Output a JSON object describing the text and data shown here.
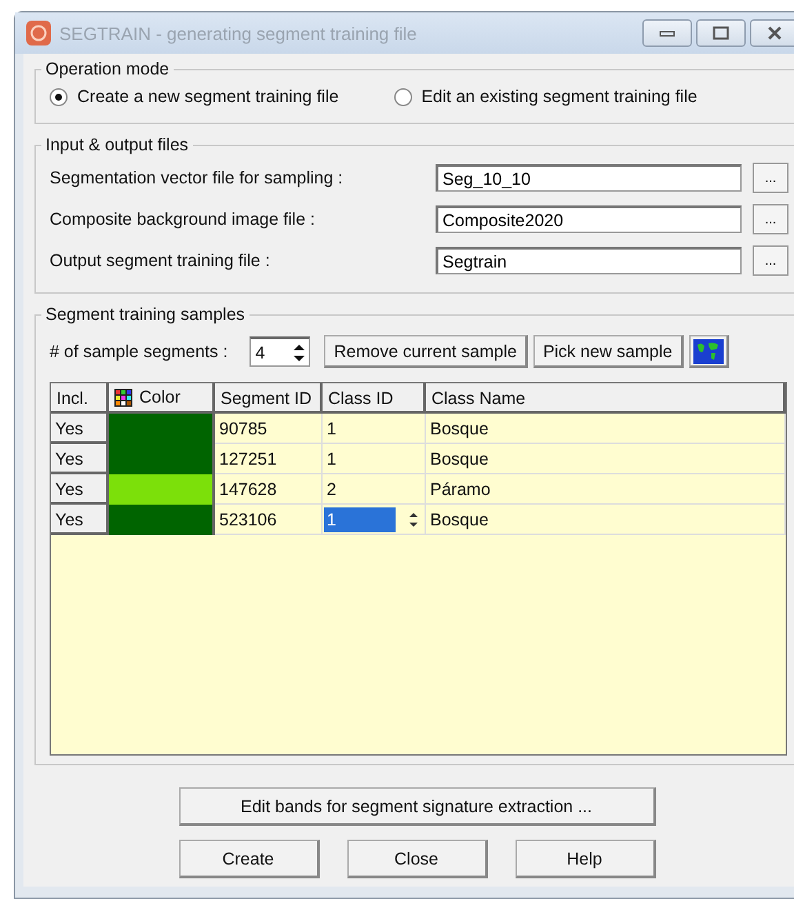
{
  "window": {
    "title": "SEGTRAIN - generating segment training file"
  },
  "operation_mode": {
    "title": "Operation mode",
    "options": [
      {
        "label": "Create a new segment training file",
        "selected": true
      },
      {
        "label": "Edit an existing segment training file",
        "selected": false
      }
    ]
  },
  "files": {
    "title": "Input & output files",
    "rows": [
      {
        "label": "Segmentation vector file for sampling :",
        "value": "Seg_10_10",
        "button": "..."
      },
      {
        "label": "Composite background image file :",
        "value": "Composite2020",
        "button": "..."
      },
      {
        "label": "Output segment training file :",
        "value": "Segtrain",
        "button": "..."
      }
    ]
  },
  "samples": {
    "title": "Segment training samples",
    "count_label": "# of sample segments :",
    "count": "4",
    "buttons": [
      "Remove current sample",
      "Pick new sample"
    ],
    "table": {
      "columns": [
        "Incl.",
        "Color",
        "Segment ID",
        "Class ID",
        "Class Name"
      ],
      "rows": [
        {
          "incl": "Yes",
          "color": "#006400",
          "segment_id": "90785",
          "class_id": "1",
          "class_name": "Bosque",
          "selected": false
        },
        {
          "incl": "Yes",
          "color": "#006400",
          "segment_id": "127251",
          "class_id": "1",
          "class_name": "Bosque",
          "selected": false
        },
        {
          "incl": "Yes",
          "color": "#7ce00a",
          "segment_id": "147628",
          "class_id": "2",
          "class_name": "Páramo",
          "selected": false
        },
        {
          "incl": "Yes",
          "color": "#006400",
          "segment_id": "523106",
          "class_id": "1",
          "class_name": "Bosque",
          "selected": true
        }
      ]
    }
  },
  "edit_bands_button": "Edit bands for segment signature extraction ...",
  "buttons": [
    "Create",
    "Close",
    "Help"
  ]
}
